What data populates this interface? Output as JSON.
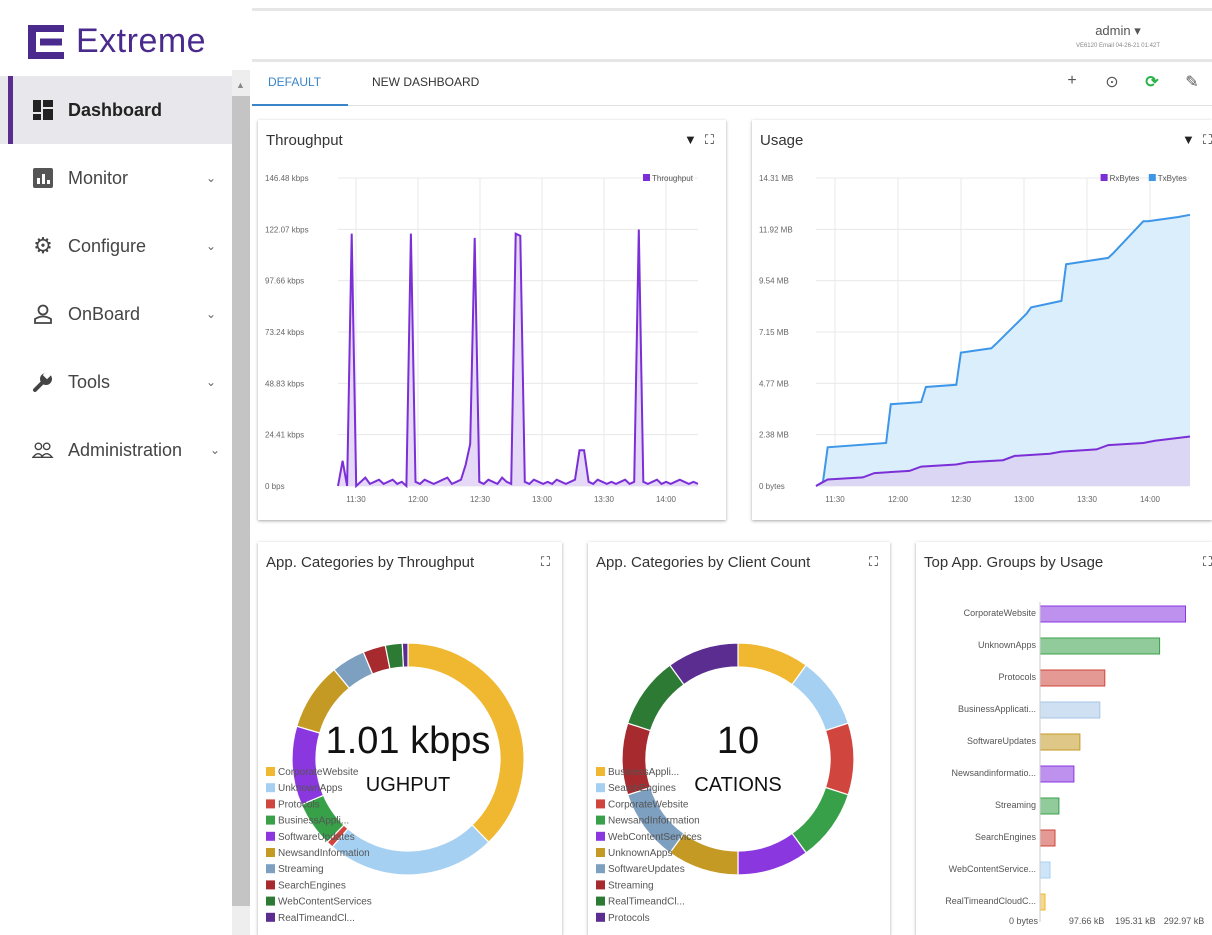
{
  "brand": {
    "name": "Extreme"
  },
  "user": {
    "name": "admin",
    "sub": "VE6120 Email 04-26-21 01:42T"
  },
  "nav": [
    {
      "label": "Dashboard",
      "icon": "dashboard-icon",
      "active": true
    },
    {
      "label": "Monitor",
      "icon": "monitor-icon"
    },
    {
      "label": "Configure",
      "icon": "gear-icon"
    },
    {
      "label": "OnBoard",
      "icon": "person-icon"
    },
    {
      "label": "Tools",
      "icon": "wrench-icon"
    },
    {
      "label": "Administration",
      "icon": "users-icon"
    }
  ],
  "tabs": [
    {
      "label": "DEFAULT",
      "active": true
    },
    {
      "label": "NEW DASHBOARD"
    }
  ],
  "tab_actions": [
    {
      "name": "add-icon",
      "glyph": "+"
    },
    {
      "name": "clock-icon",
      "glyph": "⊙"
    },
    {
      "name": "refresh-icon",
      "glyph": "⟳",
      "color": "#2bb34a"
    },
    {
      "name": "edit-icon",
      "glyph": "✎"
    }
  ],
  "colors": {
    "purple": "#7b2fd6",
    "blue": "#3d96e8",
    "purple_fill": "#e6d8f7",
    "blue_fill": "#dbeefb"
  },
  "cards": {
    "throughput": {
      "title": "Throughput"
    },
    "usage": {
      "title": "Usage"
    },
    "cat_throughput": {
      "title": "App. Categories by Throughput",
      "center": "1.01 kbps",
      "sub": "UGHPUT"
    },
    "cat_clients": {
      "title": "App. Categories by Client Count",
      "center": "10",
      "sub": "CATIONS"
    },
    "top_groups": {
      "title": "Top App. Groups by Usage"
    }
  },
  "chart_data": [
    {
      "type": "line",
      "title": "Throughput",
      "legend": [
        "Throughput"
      ],
      "xticks": [
        "11:30",
        "12:00",
        "12:30",
        "13:00",
        "13:30",
        "14:00"
      ],
      "yticks": [
        "0 bps",
        "24.41 kbps",
        "48.83 kbps",
        "73.24 kbps",
        "97.66 kbps",
        "122.07 kbps",
        "146.48 kbps"
      ],
      "ylim": [
        0,
        146.48
      ],
      "series": [
        {
          "name": "Throughput",
          "x": [
            0,
            2,
            4,
            6,
            8,
            10,
            12,
            14,
            16,
            18,
            20,
            22,
            24,
            26,
            28,
            30,
            32,
            34,
            36,
            38,
            40,
            42,
            44,
            46,
            48,
            50,
            52,
            54,
            56,
            58,
            60,
            62,
            64,
            66,
            68,
            70,
            72,
            74,
            76,
            78,
            80,
            82,
            84,
            86,
            88,
            90,
            92,
            94,
            96,
            98,
            100,
            102,
            104,
            106,
            108,
            110,
            112,
            114,
            116,
            118,
            120,
            122,
            124,
            126,
            128,
            130,
            132,
            134,
            136,
            138,
            140,
            142,
            144,
            146,
            148,
            150,
            152,
            154,
            156,
            158
          ],
          "y": [
            0,
            12,
            0,
            120,
            0,
            2,
            4,
            1,
            2,
            3,
            1,
            2,
            3,
            1,
            2,
            0,
            120,
            2,
            1,
            3,
            2,
            1,
            2,
            3,
            4,
            1,
            2,
            3,
            10,
            20,
            118,
            2,
            1,
            3,
            2,
            1,
            4,
            2,
            1,
            120,
            119,
            2,
            1,
            3,
            2,
            1,
            2,
            1,
            3,
            2,
            1,
            2,
            3,
            17,
            17,
            2,
            1,
            3,
            2,
            1,
            2,
            1,
            2,
            3,
            1,
            2,
            122,
            2,
            1,
            2,
            3,
            1,
            2,
            1,
            2,
            3,
            2,
            1,
            2,
            1
          ]
        }
      ]
    },
    {
      "type": "area",
      "title": "Usage",
      "legend": [
        "RxBytes",
        "TxBytes"
      ],
      "xticks": [
        "11:30",
        "12:00",
        "12:30",
        "13:00",
        "13:30",
        "14:00"
      ],
      "yticks": [
        "0 bytes",
        "2.38 MB",
        "4.77 MB",
        "7.15 MB",
        "9.54 MB",
        "11.92 MB",
        "14.31 MB"
      ],
      "ylim": [
        0,
        14.31
      ],
      "series": [
        {
          "name": "RxBytes",
          "x": [
            0,
            5,
            20,
            25,
            40,
            45,
            60,
            65,
            80,
            85,
            100,
            105,
            120,
            125,
            140,
            145,
            160
          ],
          "y": [
            0,
            0.3,
            0.4,
            0.6,
            0.7,
            0.9,
            1.0,
            1.1,
            1.2,
            1.4,
            1.5,
            1.6,
            1.7,
            1.9,
            2.0,
            2.1,
            2.3
          ]
        },
        {
          "name": "TxBytes",
          "x": [
            0,
            3,
            5,
            30,
            32,
            45,
            47,
            60,
            62,
            75,
            77,
            90,
            92,
            105,
            107,
            125,
            127,
            140,
            142,
            155,
            160
          ],
          "y": [
            0,
            0.2,
            1.8,
            2.0,
            3.8,
            3.9,
            4.6,
            4.7,
            6.2,
            6.4,
            6.6,
            8.0,
            8.3,
            8.6,
            10.3,
            10.6,
            10.8,
            12.3,
            12.3,
            12.5,
            12.6
          ]
        }
      ]
    },
    {
      "type": "pie",
      "title": "App. Categories by Throughput",
      "categories": [
        "CorporateWebsite",
        "UnknownApps",
        "Protocols",
        "BusinessAppli...",
        "SoftwareUpdates",
        "NewsandInformation",
        "Streaming",
        "SearchEngines",
        "WebContentServices",
        "RealTimeandCl..."
      ],
      "values": [
        24,
        15,
        0.6,
        4,
        7,
        6,
        3,
        2,
        1.5,
        0.5
      ],
      "colors": [
        "#f0b730",
        "#a6d0f2",
        "#d0453d",
        "#38a049",
        "#8a37e0",
        "#c49a24",
        "#7d9fc0",
        "#a62a2e",
        "#2c7a34",
        "#5c2d91"
      ]
    },
    {
      "type": "pie",
      "title": "App. Categories by Client Count",
      "categories": [
        "BusinessAppli...",
        "SearchEngines",
        "CorporateWebsite",
        "NewsandInformation",
        "WebContentServices",
        "UnknownApps",
        "SoftwareUpdates",
        "Streaming",
        "RealTimeandCl...",
        "Protocols"
      ],
      "values": [
        1,
        1,
        1,
        1,
        1,
        1,
        1,
        1,
        1,
        1
      ],
      "colors": [
        "#f0b730",
        "#a6d0f2",
        "#d0453d",
        "#38a049",
        "#8a37e0",
        "#c49a24",
        "#7d9fc0",
        "#a62a2e",
        "#2c7a34",
        "#5c2d91"
      ]
    },
    {
      "type": "bar",
      "title": "Top App. Groups by Usage",
      "categories": [
        "CorporateWebsite",
        "UnknownApps",
        "Protocols",
        "BusinessApplicati...",
        "SoftwareUpdates",
        "Newsandinformatio...",
        "Streaming",
        "SearchEngines",
        "WebContentService...",
        "RealTimeandCloudC..."
      ],
      "values": [
        292,
        240,
        130,
        120,
        80,
        68,
        38,
        30,
        20,
        10
      ],
      "colors": [
        "#8a37e0",
        "#38a049",
        "#d0453d",
        "#a6c6e6",
        "#c49a24",
        "#8a37e0",
        "#38a049",
        "#d0453d",
        "#a6d0f2",
        "#f0b730"
      ],
      "xticks": [
        "0 bytes",
        "97.66 kB",
        "195.31 kB",
        "292.97 kB"
      ]
    }
  ]
}
